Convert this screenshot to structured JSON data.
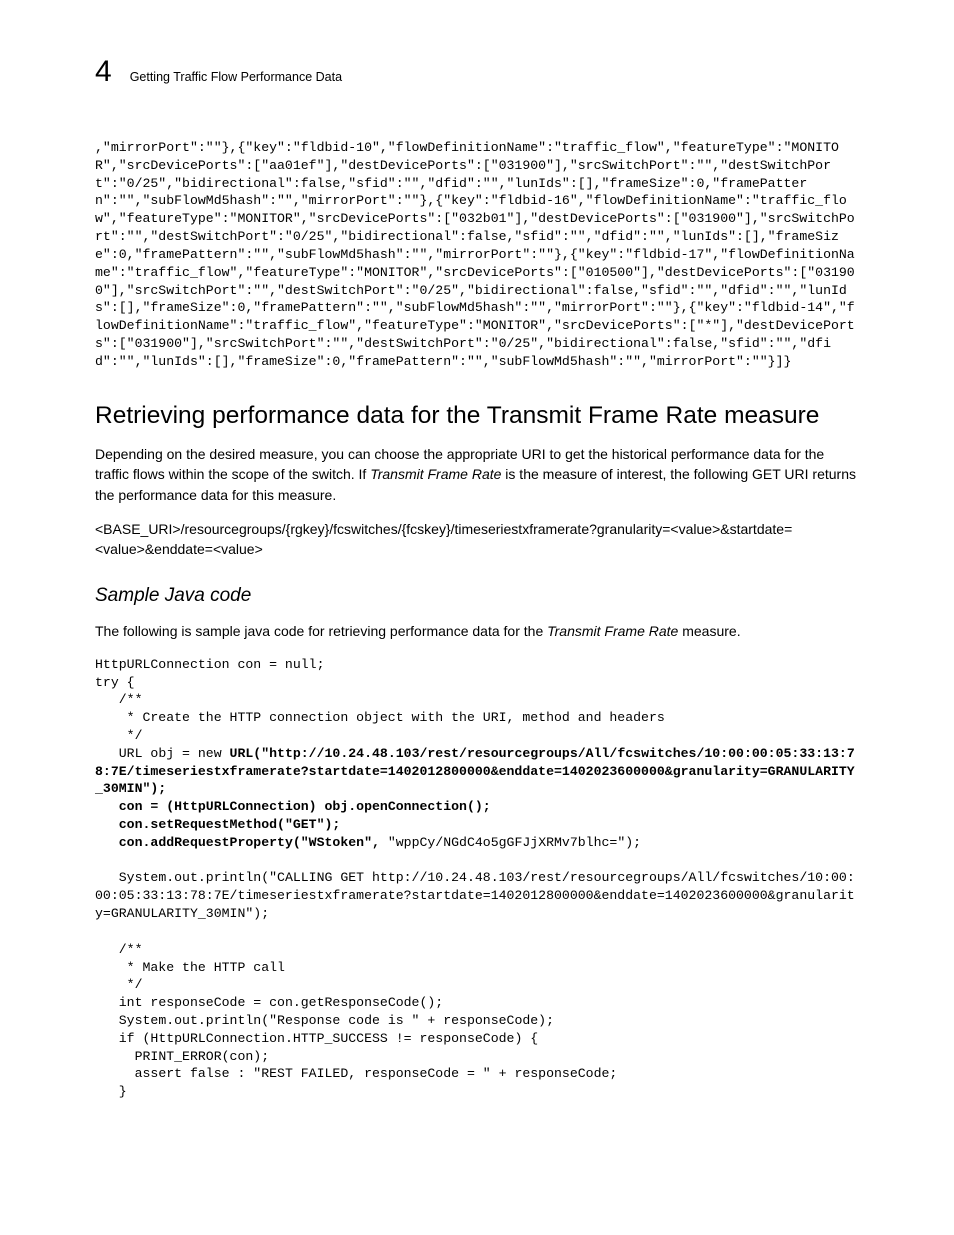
{
  "header": {
    "chapter_number": "4",
    "running_title": "Getting Traffic Flow Performance Data"
  },
  "code_top": ",\"mirrorPort\":\"\"},{\"key\":\"fldbid-10\",\"flowDefinitionName\":\"traffic_flow\",\"featureType\":\"MONITOR\",\"srcDevicePorts\":[\"aa01ef\"],\"destDevicePorts\":[\"031900\"],\"srcSwitchPort\":\"\",\"destSwitchPort\":\"0/25\",\"bidirectional\":false,\"sfid\":\"\",\"dfid\":\"\",\"lunIds\":[],\"frameSize\":0,\"framePattern\":\"\",\"subFlowMd5hash\":\"\",\"mirrorPort\":\"\"},{\"key\":\"fldbid-16\",\"flowDefinitionName\":\"traffic_flow\",\"featureType\":\"MONITOR\",\"srcDevicePorts\":[\"032b01\"],\"destDevicePorts\":[\"031900\"],\"srcSwitchPort\":\"\",\"destSwitchPort\":\"0/25\",\"bidirectional\":false,\"sfid\":\"\",\"dfid\":\"\",\"lunIds\":[],\"frameSize\":0,\"framePattern\":\"\",\"subFlowMd5hash\":\"\",\"mirrorPort\":\"\"},{\"key\":\"fldbid-17\",\"flowDefinitionName\":\"traffic_flow\",\"featureType\":\"MONITOR\",\"srcDevicePorts\":[\"010500\"],\"destDevicePorts\":[\"031900\"],\"srcSwitchPort\":\"\",\"destSwitchPort\":\"0/25\",\"bidirectional\":false,\"sfid\":\"\",\"dfid\":\"\",\"lunIds\":[],\"frameSize\":0,\"framePattern\":\"\",\"subFlowMd5hash\":\"\",\"mirrorPort\":\"\"},{\"key\":\"fldbid-14\",\"flowDefinitionName\":\"traffic_flow\",\"featureType\":\"MONITOR\",\"srcDevicePorts\":[\"*\"],\"destDevicePorts\":[\"031900\"],\"srcSwitchPort\":\"\",\"destSwitchPort\":\"0/25\",\"bidirectional\":false,\"sfid\":\"\",\"dfid\":\"\",\"lunIds\":[],\"frameSize\":0,\"framePattern\":\"\",\"subFlowMd5hash\":\"\",\"mirrorPort\":\"\"}]}",
  "section": {
    "heading": "Retrieving performance data for the Transmit Frame Rate measure",
    "para1_a": "Depending on the desired measure, you can choose the appropriate URI to get the historical performance data for the traffic flows within the scope of the switch. If ",
    "para1_em": "Transmit Frame Rate",
    "para1_b": " is the measure of interest, the following GET URI returns the performance data for this measure.",
    "uri": "<BASE_URI>/resourcegroups/{rgkey}/fcswitches/{fcskey}/timeseriestxframerate?granularity=<value>&startdate=<value>&enddate=<value>"
  },
  "sample": {
    "heading": "Sample Java code",
    "intro_a": "The following is sample java code for retrieving performance data for the ",
    "intro_em": "Transmit Frame Rate",
    "intro_b": " measure.",
    "code": {
      "l1": "HttpURLConnection con = null;",
      "l2": "try {",
      "l3": "   /**",
      "l4": "    * Create the HTTP connection object with the URI, method and headers",
      "l5": "    */",
      "l6": "   URL obj = new ",
      "l7": "URL(\"http://10.24.48.103/rest/resourcegroups/All/fcswitches/10:00:00:05:33:13:78:7E/timeseriestxframerate?startdate=1402012800000&enddate=1402023600000&granularity=GRANULARITY_30MIN\");",
      "l8": "   con = (HttpURLConnection) obj.openConnection();",
      "l9": "   con.setRequestMethod(\"GET\");",
      "l10a": "   con.addRequestProperty(\"WStoken\", ",
      "l10b": "\"wppCy/NGdC4o5gGFJjXRMv7blhc=\");",
      "blank1": " ",
      "l11": "   System.out.println(\"CALLING GET http://10.24.48.103/rest/resourcegroups/All/fcswitches/10:00:00:05:33:13:78:7E/timeseriestxframerate?startdate=1402012800000&enddate=1402023600000&granularity=GRANULARITY_30MIN\");",
      "blank2": " ",
      "l12": "   /**",
      "l13": "    * Make the HTTP call",
      "l14": "    */",
      "l15": "   int responseCode = con.getResponseCode();",
      "l16": "   System.out.println(\"Response code is \" + responseCode);",
      "l17": "   if (HttpURLConnection.HTTP_SUCCESS != responseCode) {",
      "l18": "     PRINT_ERROR(con);",
      "l19": "     assert false : \"REST FAILED, responseCode = \" + responseCode;",
      "l20": "   }"
    }
  }
}
